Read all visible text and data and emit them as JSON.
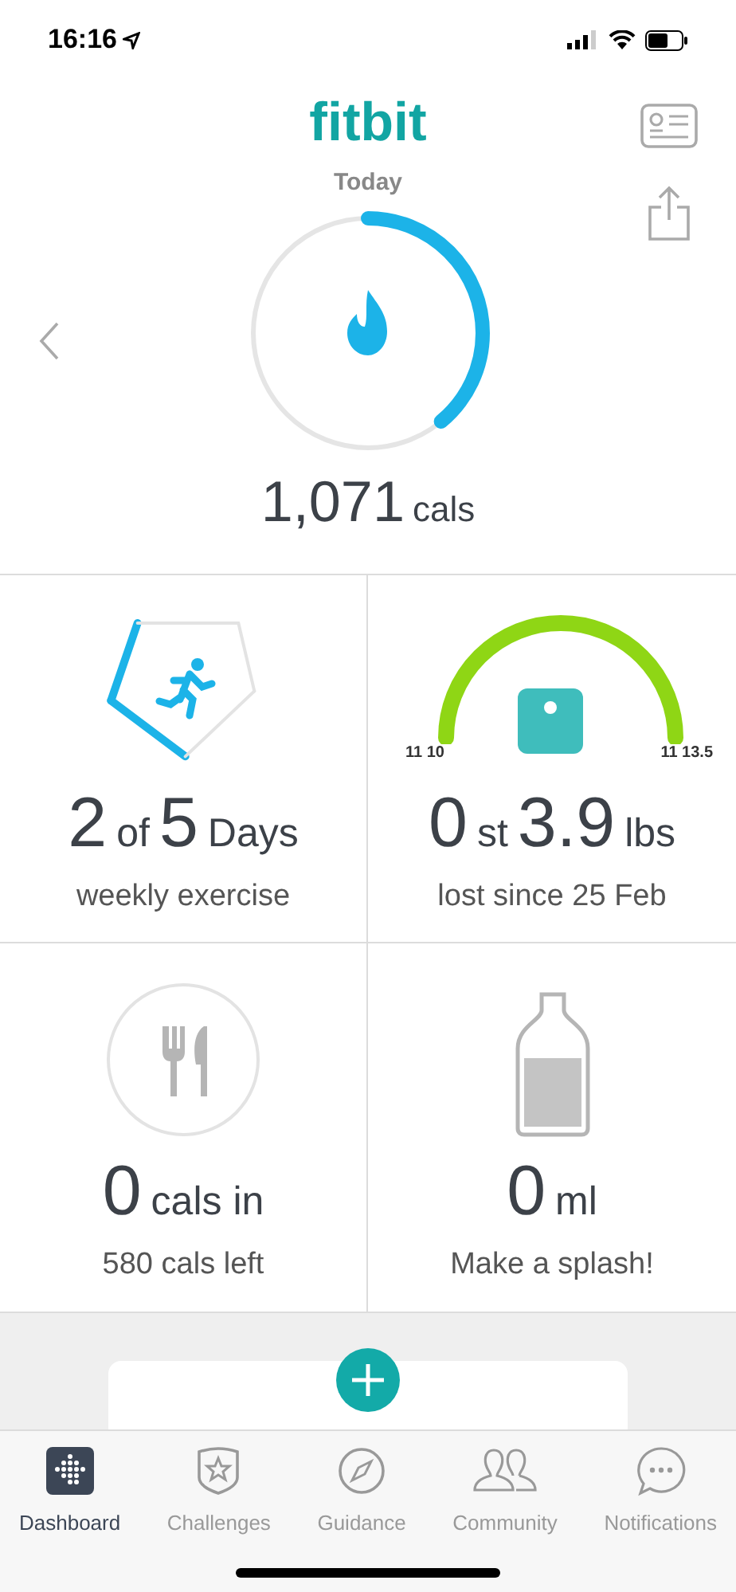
{
  "status_bar": {
    "time": "16:16"
  },
  "header": {
    "logo": "fitbit",
    "date": "Today"
  },
  "calories": {
    "level": 0.39,
    "value": "1,071",
    "unit": "cals"
  },
  "tiles": [
    {
      "kind": "exercise",
      "big1": "2",
      "small1": "of",
      "big2": "5",
      "small2": "Days",
      "caption": "weekly exercise"
    },
    {
      "kind": "weight",
      "big1": "0",
      "small1": "st",
      "big2": "3.9",
      "small2": "lbs",
      "caption": "lost since 25 Feb"
    },
    {
      "kind": "food",
      "big1": "0",
      "small1": "cals in",
      "caption": "580 cals left"
    },
    {
      "kind": "water",
      "big1": "0",
      "small1": "ml",
      "caption": "Make a splash!"
    }
  ],
  "weight_gauge": {
    "start_label": "11 10",
    "end_label": "11 13.5"
  },
  "tabs": [
    {
      "label": "Dashboard",
      "selected": true
    },
    {
      "label": "Challenges",
      "selected": false
    },
    {
      "label": "Guidance",
      "selected": false
    },
    {
      "label": "Community",
      "selected": false
    },
    {
      "label": "Notifications",
      "selected": false
    }
  ]
}
